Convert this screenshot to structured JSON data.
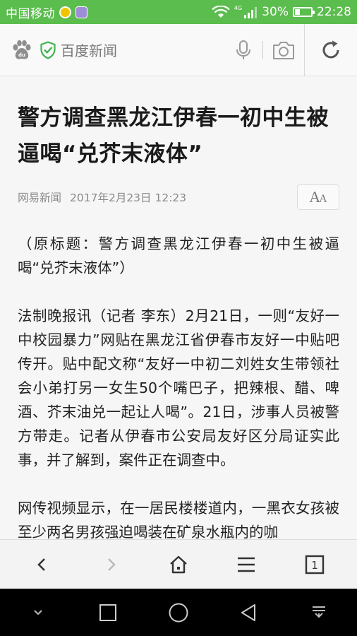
{
  "status_bar": {
    "carrier": "中国移动",
    "network_type": "4G",
    "battery_percent_text": "30%",
    "battery_level": 0.3,
    "time": "22:28",
    "icons": [
      "wechat-notification-icon",
      "message-notification-icon",
      "wifi-icon",
      "signal-icon",
      "battery-icon"
    ],
    "color": "#5bbd4e"
  },
  "address_bar": {
    "site_name": "百度新闻",
    "icons": [
      "baidu-paw-icon",
      "secure-shield-icon",
      "microphone-icon",
      "camera-icon",
      "refresh-icon"
    ],
    "shield_color": "#3fb34f"
  },
  "article": {
    "headline": "警方调查黑龙江伊春一初中生被逼喝“兑芥末液体”",
    "source": "网易新闻",
    "datetime": "2017年2月23日 12:23",
    "font_button_label": "AA",
    "paragraphs": [
      "（原标题：警方调查黑龙江伊春一初中生被逼喝“兑芥末液体”）",
      "法制晚报讯（记者 李东）2月21日，一则“友好一中校园暴力”网贴在黑龙江省伊春市友好一中贴吧传开。贴中配文称“友好一中初二刘姓女生带领社会小弟打另一女生50个嘴巴子，把辣根、醋、啤酒、芥末油兑一起让人喝”。21日，涉事人员被警方带走。记者从伊春市公安局友好区分局证实此事，并了解到，案件正在调查中。",
      "网传视频显示，在一居民楼楼道内，一黑衣女孩被至少两名男孩强迫喝装在矿泉水瓶内的咖"
    ]
  },
  "toolbar": {
    "tab_count": "1",
    "icons": [
      "back-icon",
      "forward-icon",
      "home-icon",
      "menu-icon",
      "tabs-icon"
    ]
  },
  "nav_bar": {
    "icons": [
      "hide-keyboard-icon",
      "recents-icon",
      "home-circle-icon",
      "back-triangle-icon",
      "notification-pull-icon"
    ]
  }
}
